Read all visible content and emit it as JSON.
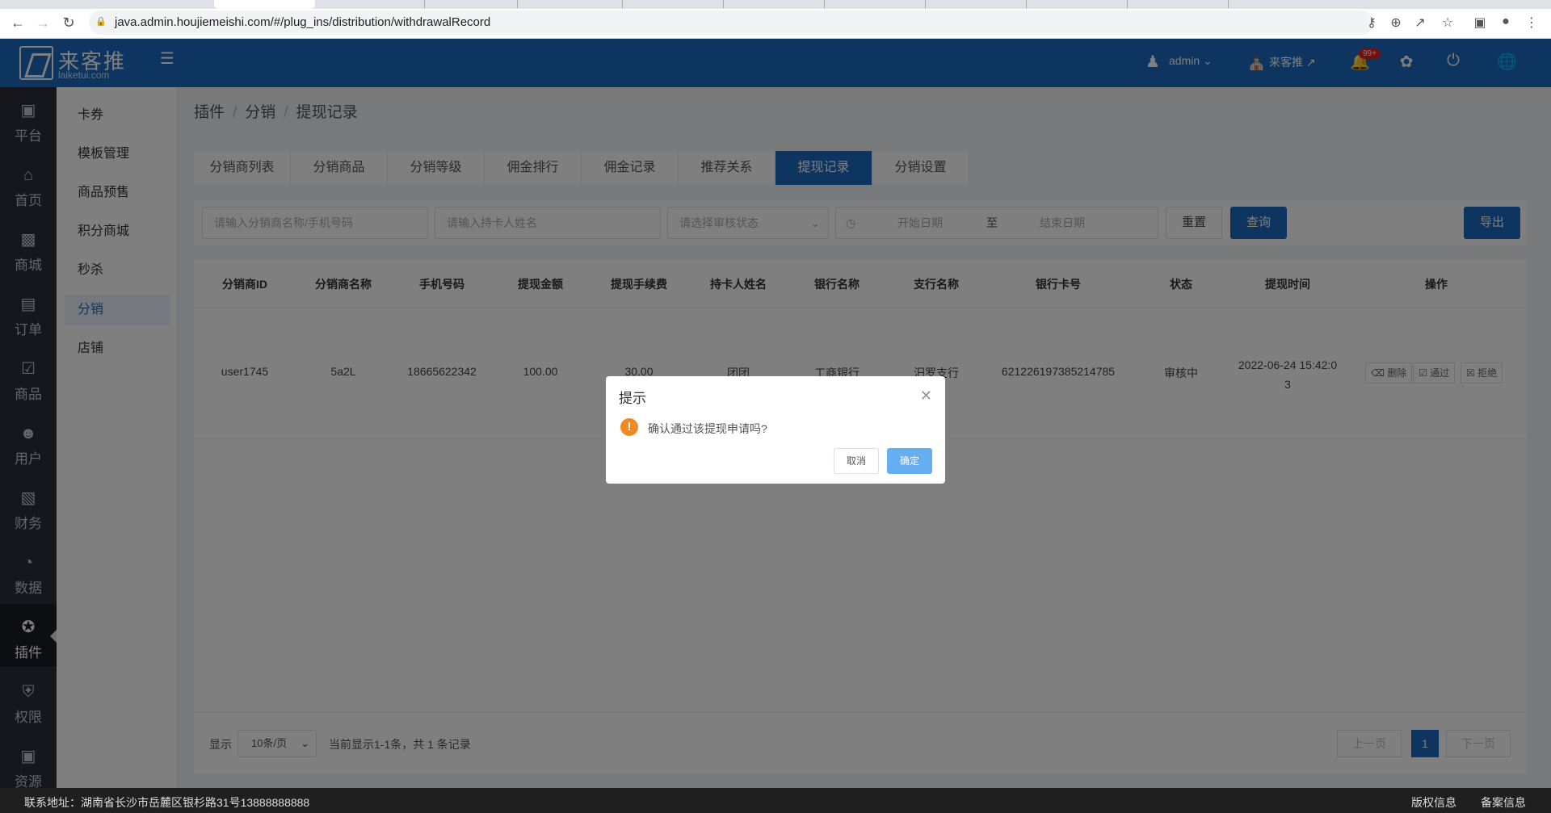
{
  "browser": {
    "url": "java.admin.houjiemeishi.com/#/plug_ins/distribution/withdrawalRecord"
  },
  "header": {
    "logo_text": "来客推",
    "logo_sub": "laiketui.com",
    "user": "admin",
    "store": "来客推",
    "badge": "99+"
  },
  "sidebar": {
    "items": [
      {
        "label": "平台",
        "icon": "platform-icon"
      },
      {
        "label": "首页",
        "icon": "home-icon"
      },
      {
        "label": "商城",
        "icon": "mall-icon"
      },
      {
        "label": "订单",
        "icon": "order-icon"
      },
      {
        "label": "商品",
        "icon": "product-icon"
      },
      {
        "label": "用户",
        "icon": "user-icon"
      },
      {
        "label": "财务",
        "icon": "wallet-icon"
      },
      {
        "label": "数据",
        "icon": "pie-chart-icon"
      },
      {
        "label": "插件",
        "icon": "puzzle-icon"
      },
      {
        "label": "权限",
        "icon": "shield-icon"
      },
      {
        "label": "资源",
        "icon": "image-icon"
      }
    ]
  },
  "subnav": {
    "items": [
      "卡券",
      "模板管理",
      "商品预售",
      "积分商城",
      "秒杀",
      "分销",
      "店铺"
    ]
  },
  "breadcrumb": [
    "插件",
    "分销",
    "提现记录"
  ],
  "tabs": [
    "分销商列表",
    "分销商品",
    "分销等级",
    "佣金排行",
    "佣金记录",
    "推荐关系",
    "提现记录",
    "分销设置"
  ],
  "filters": {
    "name_placeholder": "请输入分销商名称/手机号码",
    "holder_placeholder": "请输入持卡人姓名",
    "status_placeholder": "请选择审核状态",
    "start_placeholder": "开始日期",
    "range_sep": "至",
    "end_placeholder": "结束日期",
    "reset": "重置",
    "query": "查询",
    "export": "导出"
  },
  "table": {
    "headers": [
      "分销商ID",
      "分销商名称",
      "手机号码",
      "提现金额",
      "提现手续费",
      "持卡人姓名",
      "银行名称",
      "支行名称",
      "银行卡号",
      "状态",
      "提现时间",
      "操作"
    ],
    "rows": [
      {
        "id": "user1745",
        "name": "5a2L",
        "phone": "18665622342",
        "amount": "100.00",
        "fee": "30.00",
        "holder": "团团",
        "bank": "工商银行",
        "branch": "汨罗支行",
        "card": "621226197385214785",
        "status": "审核中",
        "time_line1": "2022-06-24 15:42:0",
        "time_line2": "3",
        "op_delete": "删除",
        "op_approve": "通过",
        "op_reject": "拒绝"
      }
    ]
  },
  "pager": {
    "show": "显示",
    "per_page": "10条/页",
    "summary": "当前显示1-1条，共 1 条记录",
    "prev": "上一页",
    "current": "1",
    "next": "下一页"
  },
  "footer": {
    "address": "联系地址：湖南省长沙市岳麓区银杉路31号13888888888",
    "copyright": "版权信息",
    "record": "备案信息"
  },
  "dialog": {
    "title": "提示",
    "message": "确认通过该提现申请吗?",
    "cancel": "取消",
    "confirm": "确定"
  }
}
